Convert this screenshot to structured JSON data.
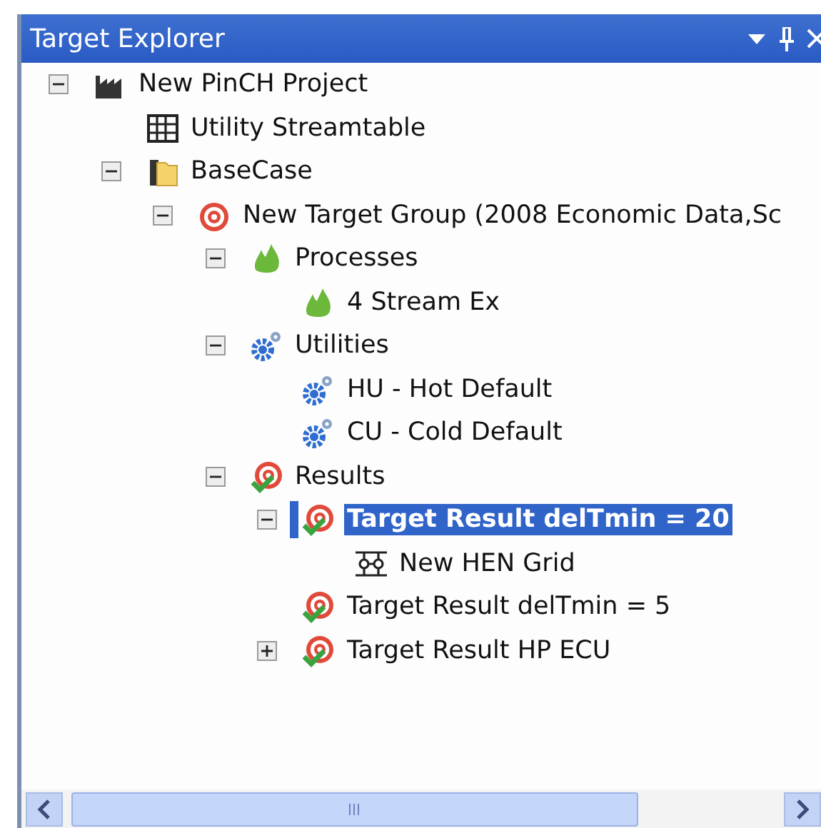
{
  "panel": {
    "title": "Target Explorer"
  },
  "tree": [
    {
      "label": "New PinCH Project",
      "kind": "factory",
      "selected": false,
      "expanded": true,
      "children": [
        {
          "label": "Utility Streamtable",
          "kind": "table",
          "selected": false
        },
        {
          "label": "BaseCase",
          "kind": "folder",
          "selected": false,
          "expanded": true,
          "children": [
            {
              "label": "New Target Group (2008 Economic Data,Sc",
              "kind": "target",
              "selected": false,
              "expanded": true,
              "children": [
                {
                  "label": "Processes",
                  "kind": "flame",
                  "selected": false,
                  "expanded": true,
                  "children": [
                    {
                      "label": "4 Stream Ex",
                      "kind": "flame",
                      "selected": false
                    }
                  ]
                },
                {
                  "label": "Utilities",
                  "kind": "gears",
                  "selected": false,
                  "expanded": true,
                  "children": [
                    {
                      "label": "HU - Hot Default",
                      "kind": "gears",
                      "selected": false
                    },
                    {
                      "label": "CU - Cold Default",
                      "kind": "gears",
                      "selected": false
                    }
                  ]
                },
                {
                  "label": "Results",
                  "kind": "result",
                  "selected": false,
                  "expanded": true,
                  "children": [
                    {
                      "label": "Target Result delTmin = 20",
                      "kind": "result",
                      "selected": true,
                      "expanded": true,
                      "children": [
                        {
                          "label": "New HEN Grid",
                          "kind": "grid",
                          "selected": false
                        }
                      ]
                    },
                    {
                      "label": "Target Result delTmin = 5",
                      "kind": "result",
                      "selected": false
                    },
                    {
                      "label": "Target Result HP ECU",
                      "kind": "result",
                      "selected": false,
                      "expanded": false
                    }
                  ]
                }
              ]
            }
          ]
        }
      ]
    }
  ]
}
